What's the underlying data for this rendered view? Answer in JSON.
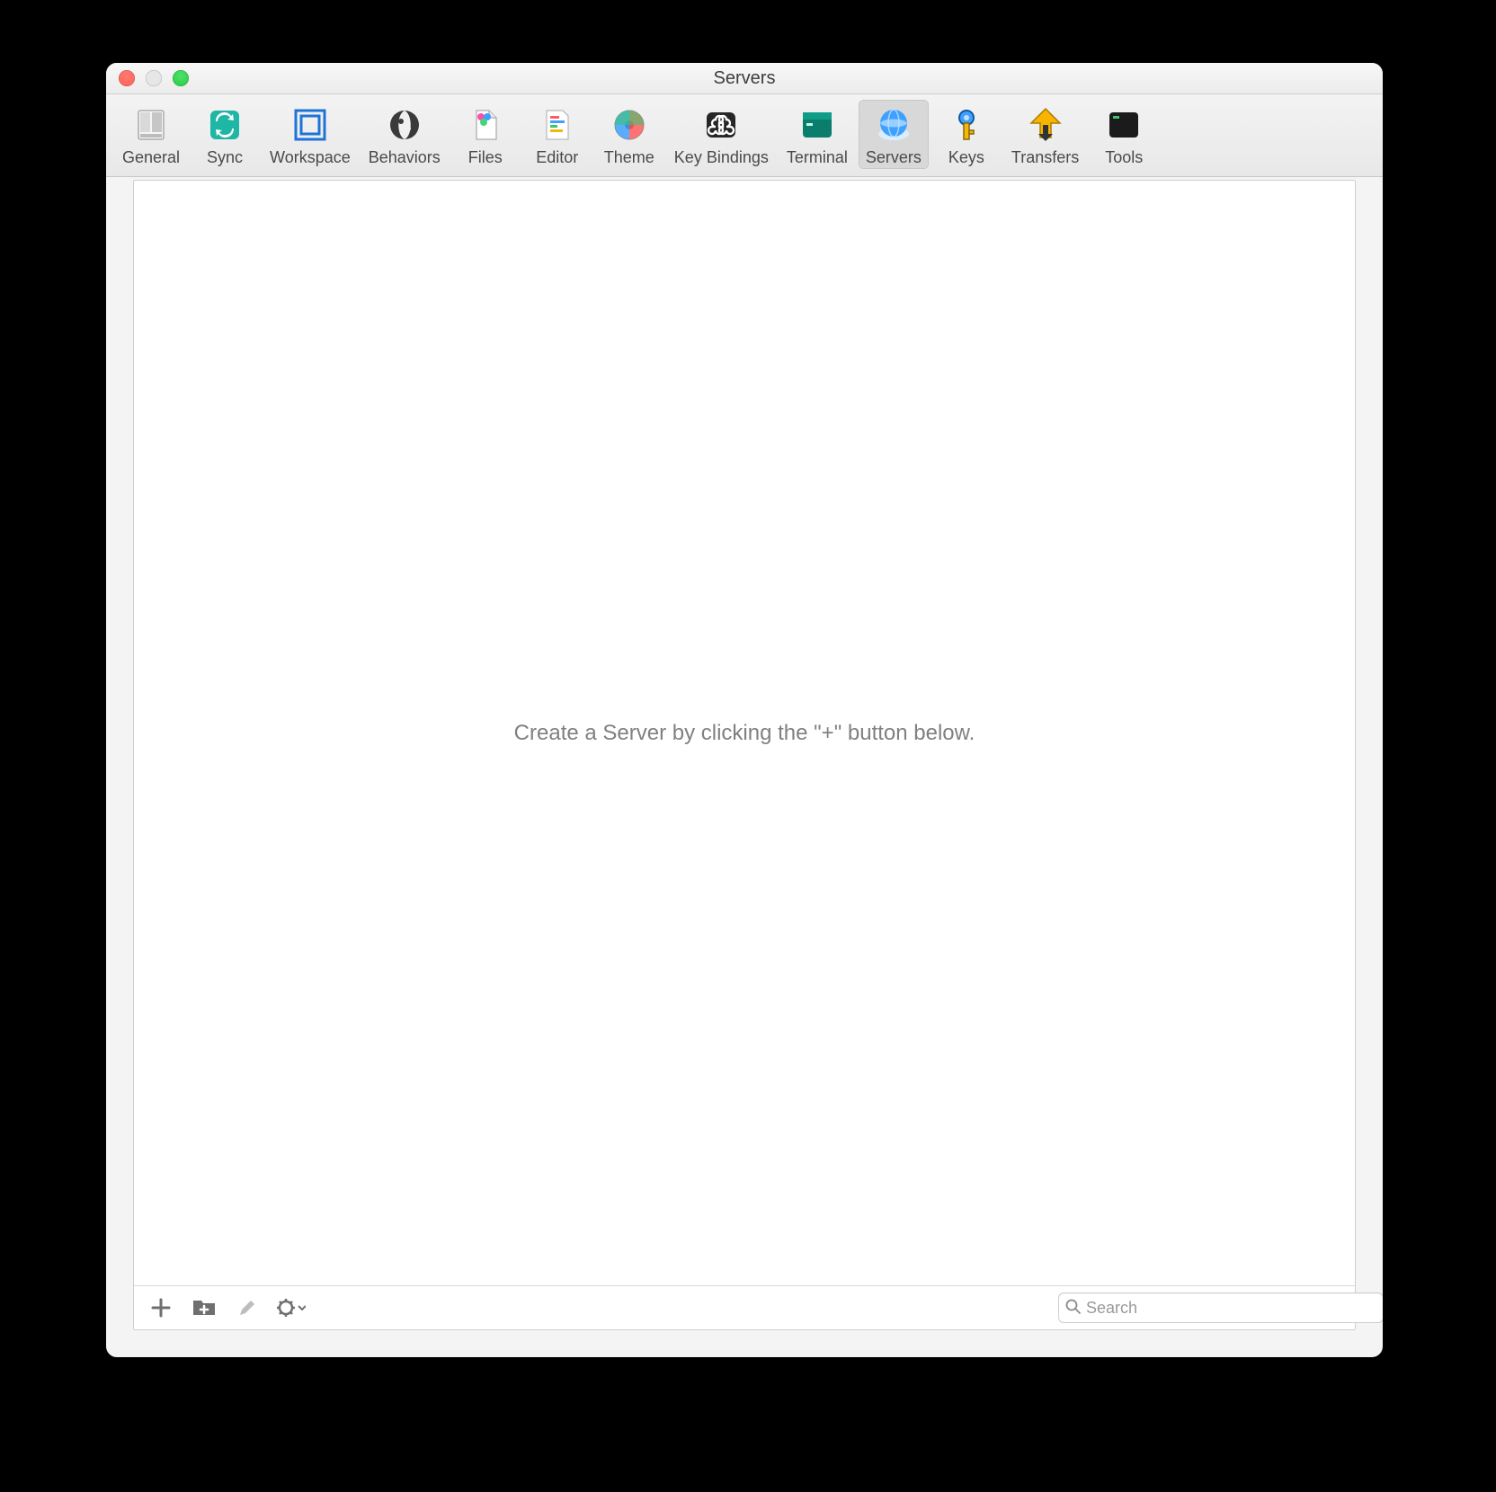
{
  "window": {
    "title": "Servers"
  },
  "toolbar": {
    "selected": "Servers",
    "items": [
      {
        "label": "General"
      },
      {
        "label": "Sync"
      },
      {
        "label": "Workspace"
      },
      {
        "label": "Behaviors"
      },
      {
        "label": "Files"
      },
      {
        "label": "Editor"
      },
      {
        "label": "Theme"
      },
      {
        "label": "Key Bindings"
      },
      {
        "label": "Terminal"
      },
      {
        "label": "Servers"
      },
      {
        "label": "Keys"
      },
      {
        "label": "Transfers"
      },
      {
        "label": "Tools"
      }
    ]
  },
  "main": {
    "empty_message": "Create a Server by clicking the \"+\" button below."
  },
  "footer": {
    "search_placeholder": "Search"
  }
}
